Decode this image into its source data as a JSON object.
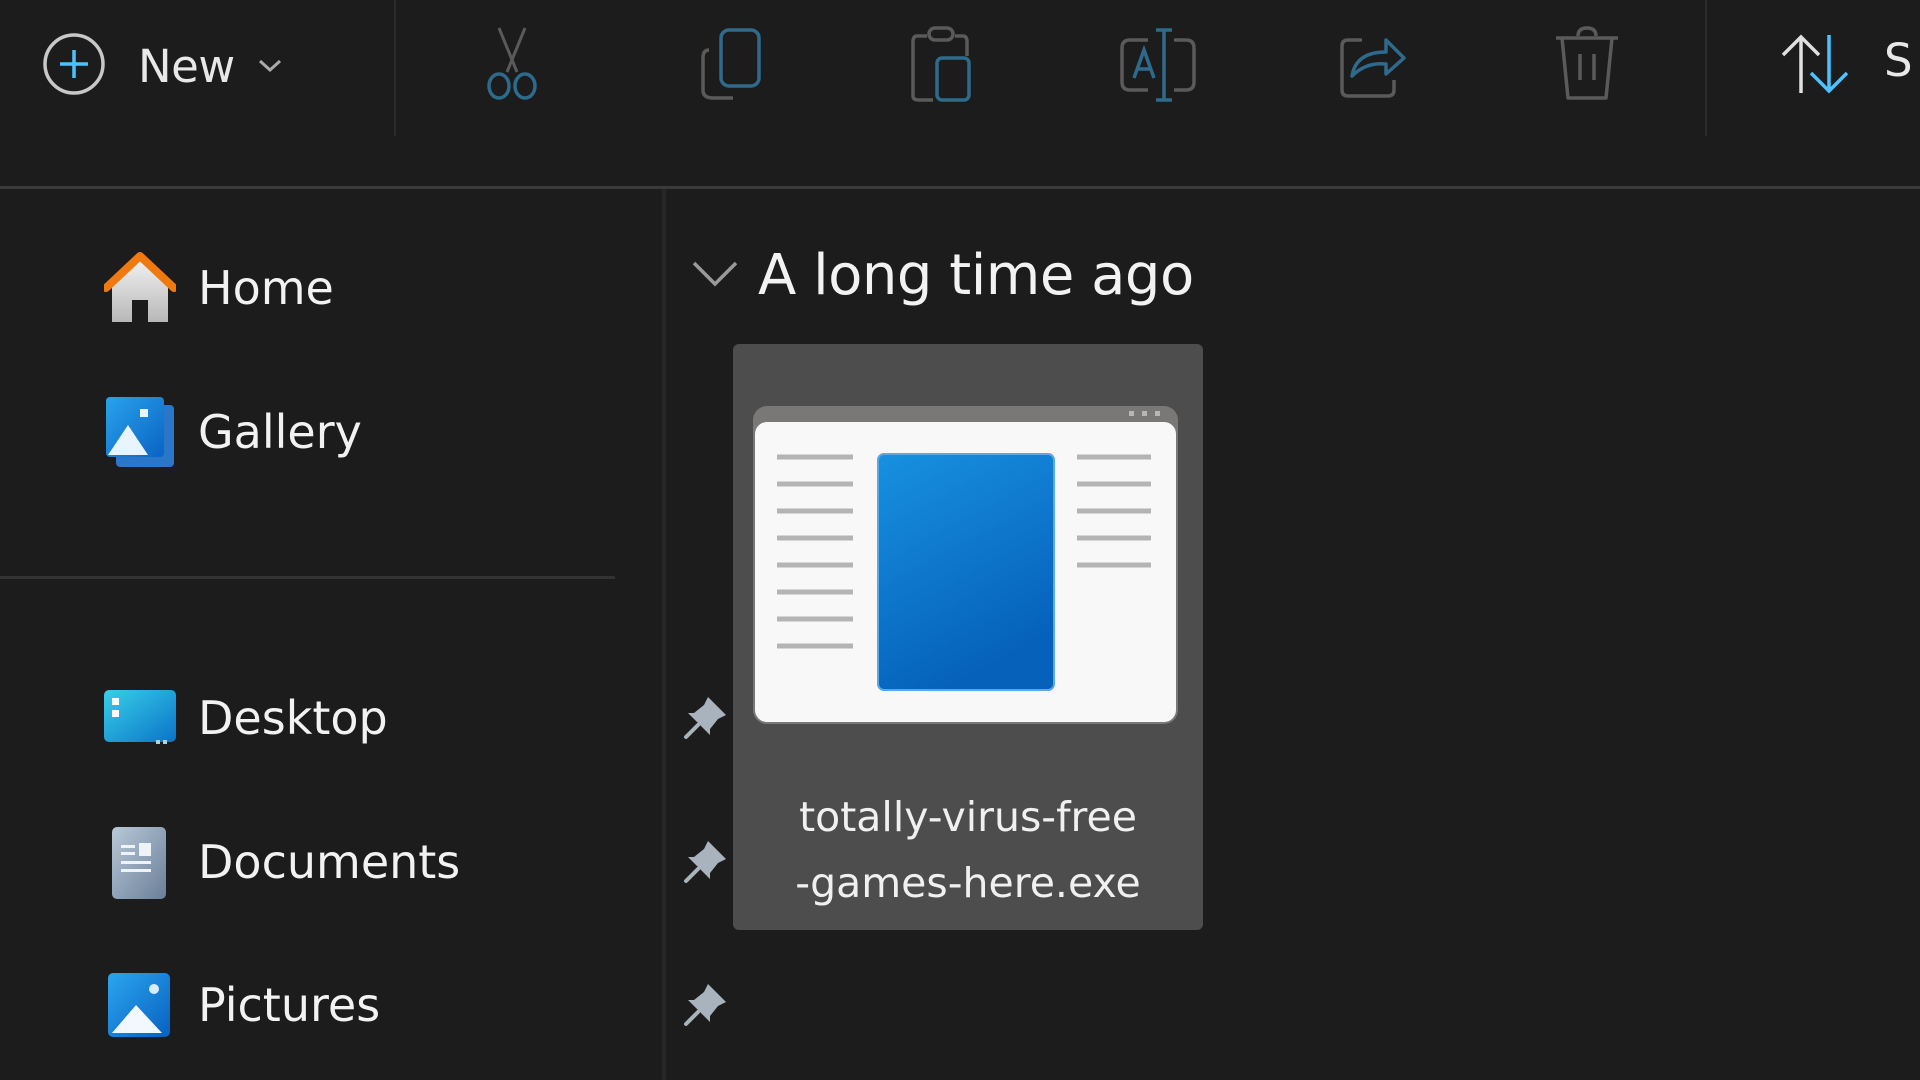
{
  "toolbar": {
    "new_label": "New",
    "new_icon": "plus-circle-icon",
    "actions": [
      {
        "name": "cut",
        "icon": "scissors-icon"
      },
      {
        "name": "copy",
        "icon": "copy-icon"
      },
      {
        "name": "paste",
        "icon": "paste-icon"
      },
      {
        "name": "rename",
        "icon": "rename-icon"
      },
      {
        "name": "share",
        "icon": "share-icon"
      },
      {
        "name": "delete",
        "icon": "trash-icon"
      }
    ],
    "sort_label": "S",
    "sort_icon": "sort-arrows-icon"
  },
  "sidebar": {
    "items": [
      {
        "label": "Home",
        "icon": "home-icon",
        "pinned": false
      },
      {
        "label": "Gallery",
        "icon": "gallery-icon",
        "pinned": false
      },
      {
        "label": "Desktop",
        "icon": "desktop-folder-icon",
        "pinned": true
      },
      {
        "label": "Documents",
        "icon": "documents-folder-icon",
        "pinned": true
      },
      {
        "label": "Pictures",
        "icon": "pictures-folder-icon",
        "pinned": true
      }
    ]
  },
  "main": {
    "group_title": "A long time ago",
    "files": [
      {
        "name_line1": "totally-virus-free",
        "name_line2": "-games-here.exe",
        "full_name": "totally-virus-free-games-here.exe",
        "icon": "application-exe-icon",
        "selected": true
      }
    ]
  },
  "colors": {
    "background": "#1c1c1c",
    "accent": "#4cc2ff",
    "tile_selected": "#4d4d4d",
    "disabled_icon_blue": "#2e6a8c"
  }
}
